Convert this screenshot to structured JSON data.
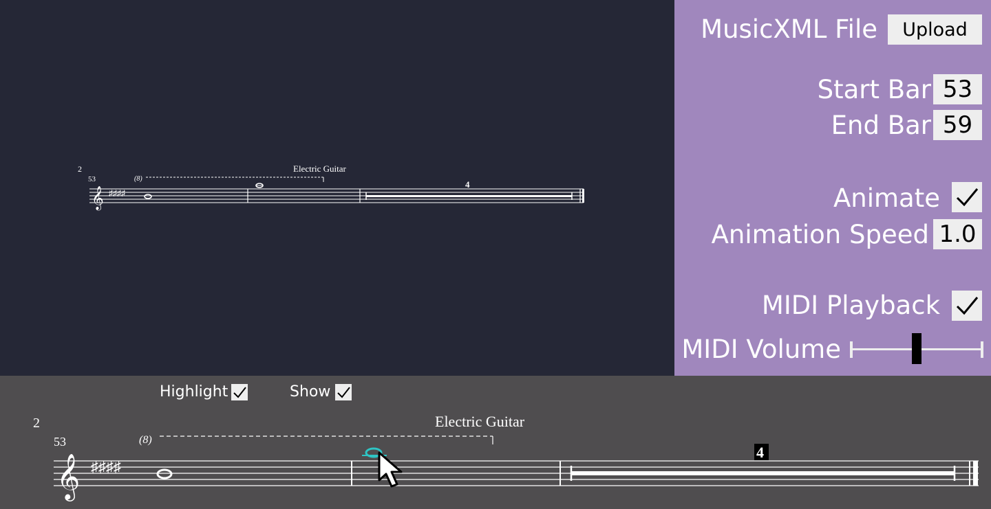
{
  "controls": {
    "musicxml_label": "MusicXML File",
    "upload_label": "Upload",
    "start_bar_label": "Start Bar",
    "start_bar_value": "53",
    "end_bar_label": "End Bar",
    "end_bar_value": "59",
    "animate_label": "Animate",
    "animate_checked": true,
    "animation_speed_label": "Animation Speed",
    "animation_speed_value": "1.0",
    "midi_playback_label": "MIDI Playback",
    "midi_playback_checked": true,
    "midi_volume_label": "MIDI Volume",
    "midi_volume_level": 0.5
  },
  "bottom_options": {
    "highlight_label": "Highlight",
    "highlight_checked": true,
    "show_label": "Show",
    "show_checked": true
  },
  "score": {
    "system_number": "2",
    "measure_number": "53",
    "instrument_name": "Electric Guitar",
    "ottava_marking": "(8)",
    "multirest_count": "4"
  },
  "colors": {
    "score_background": "#252736",
    "panel_background": "#a087bd",
    "bottom_background": "#4f4d4f",
    "highlight_note": "#2ec4c4"
  }
}
